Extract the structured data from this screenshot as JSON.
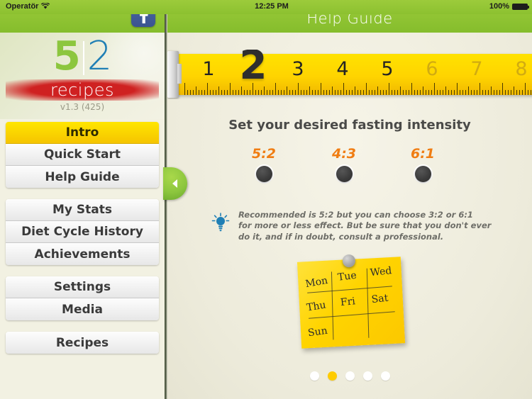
{
  "status_bar": {
    "carrier": "Operatör",
    "wifi_icon": "wifi-icon",
    "time": "12:25 PM",
    "battery_percent": "100%",
    "battery_icon": "battery-full-icon"
  },
  "sidebar": {
    "facebook_button_icon": "facebook-icon",
    "logo": {
      "number_left": "5",
      "number_right": "2",
      "word": "recipes",
      "version": "v1.3 (425)"
    },
    "groups": [
      {
        "items": [
          {
            "label": "Intro",
            "active": true
          },
          {
            "label": "Quick Start",
            "active": false
          },
          {
            "label": "Help Guide",
            "active": false
          }
        ]
      },
      {
        "items": [
          {
            "label": "My Stats",
            "active": false
          },
          {
            "label": "Diet Cycle History",
            "active": false
          },
          {
            "label": "Achievements",
            "active": false
          }
        ]
      },
      {
        "items": [
          {
            "label": "Settings",
            "active": false
          },
          {
            "label": "Media",
            "active": false
          }
        ]
      },
      {
        "items": [
          {
            "label": "Recipes",
            "active": false
          }
        ]
      }
    ]
  },
  "main": {
    "header_title": "Help Guide",
    "tape_measure": {
      "highlighted_number": "2",
      "numbers": [
        "1",
        "2",
        "3",
        "4",
        "5",
        "6",
        "7",
        "8"
      ],
      "dim_from_index": 5
    },
    "section_title": "Set your desired fasting intensity",
    "options": [
      {
        "label": "5:2",
        "selected": false
      },
      {
        "label": "4:3",
        "selected": false
      },
      {
        "label": "6:1",
        "selected": false
      }
    ],
    "tip": {
      "icon": "lightbulb-icon",
      "lines": [
        "Recommended is 5:2 but you can choose 3:2 or 6:1",
        "for more or less effect. But be sure that you don't ever",
        "do it, and if in doubt, consult a professional."
      ]
    },
    "sticky_note": {
      "pin_icon": "pin-icon",
      "days": [
        "Mon",
        "Tue",
        "Wed",
        "Thu",
        "Fri",
        "Sat",
        "Sun"
      ]
    },
    "pagination": {
      "total": 5,
      "active_index": 1
    },
    "prev_arrow_icon": "arrow-left-icon",
    "next_arrow_icon": "arrow-right-icon",
    "panel_toggle_icon": "chevron-left-icon"
  },
  "colors": {
    "green": "#8cc63e",
    "yellow": "#ffd400",
    "orange": "#f07d13",
    "red": "#cf2121",
    "blue": "#1f7fb5"
  }
}
